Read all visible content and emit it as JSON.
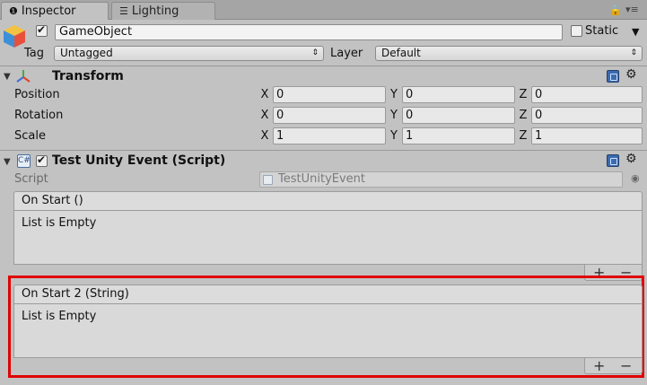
{
  "tabs": {
    "inspector": "Inspector",
    "lighting": "Lighting"
  },
  "header": {
    "object_name": "GameObject",
    "static_label": "Static",
    "tag_label": "Tag",
    "tag_value": "Untagged",
    "layer_label": "Layer",
    "layer_value": "Default"
  },
  "transform": {
    "title": "Transform",
    "position_label": "Position",
    "rotation_label": "Rotation",
    "scale_label": "Scale",
    "x": "X",
    "y": "Y",
    "z": "Z",
    "position": [
      "0",
      "0",
      "0"
    ],
    "rotation": [
      "0",
      "0",
      "0"
    ],
    "scale": [
      "1",
      "1",
      "1"
    ]
  },
  "script_component": {
    "title": "Test Unity Event (Script)",
    "script_label": "Script",
    "script_value": "TestUnityEvent"
  },
  "events": [
    {
      "title": "On Start ()",
      "body": "List is Empty",
      "plus": "+",
      "minus": "−"
    },
    {
      "title": "On Start 2 (String)",
      "body": "List is Empty",
      "plus": "+",
      "minus": "−"
    }
  ],
  "colors": {
    "highlight": "#e00000",
    "panel": "#c2c2c2"
  }
}
